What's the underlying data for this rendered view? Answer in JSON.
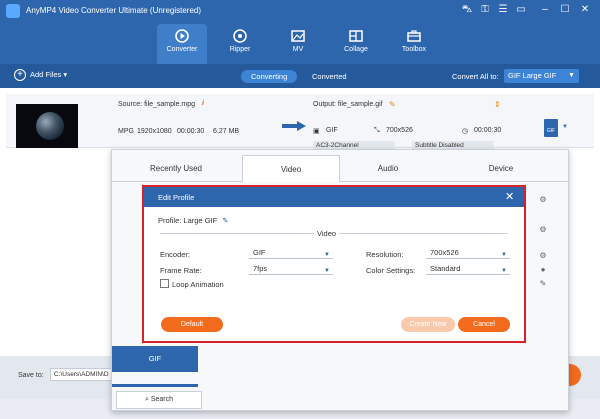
{
  "app": {
    "title": "AnyMP4 Video Converter Ultimate (Unregistered)"
  },
  "nav": {
    "tabs": [
      {
        "label": "Converter",
        "icon": "converter-icon"
      },
      {
        "label": "Ripper",
        "icon": "ripper-icon"
      },
      {
        "label": "MV",
        "icon": "mv-icon"
      },
      {
        "label": "Collage",
        "icon": "collage-icon"
      },
      {
        "label": "Toolbox",
        "icon": "toolbox-icon"
      }
    ]
  },
  "toolbar": {
    "add_files": "Add Files",
    "tab_converting": "Converting",
    "tab_converted": "Converted",
    "convert_all_label": "Convert All to:",
    "convert_all_value": "GIF Large GIF"
  },
  "file": {
    "source": "Source: file_sample.mpg",
    "format": "MPG",
    "resolution": "1920x1080",
    "duration": "00:00:30",
    "size": "6.27 MB",
    "output": "Output: file_sample.gif",
    "out_format": "GIF",
    "out_resolution": "700x526",
    "out_duration": "00:00:30",
    "audio_track": "AC3-2Channel",
    "subtitle": "Subtitle Disabled",
    "format_badge": "GIF"
  },
  "format_panel": {
    "tabs": [
      "Recently Used",
      "Video",
      "Audio",
      "Device"
    ],
    "active_tab": "Video",
    "selected_format": "GIF",
    "search_label": "Search"
  },
  "bottom": {
    "save_to_label": "Save to:",
    "save_path": "C:\\Users\\ADMIN\\D"
  },
  "dialog": {
    "title": "Edit Profile",
    "profile": "Profile: Large GIF",
    "section": "Video",
    "encoder_label": "Encoder:",
    "encoder_value": "GIF",
    "resolution_label": "Resolution:",
    "resolution_value": "700x526",
    "frame_rate_label": "Frame Rate:",
    "frame_rate_value": "7fps",
    "color_settings_label": "Color Settings:",
    "color_settings_value": "Standard",
    "loop_label": "Loop Animation",
    "default_btn": "Default",
    "create_new_btn": "Create New",
    "cancel_btn": "Cancel"
  },
  "colors": {
    "primary": "#2e66ad",
    "accent": "#f36b1c",
    "highlight": "#d6202a"
  }
}
